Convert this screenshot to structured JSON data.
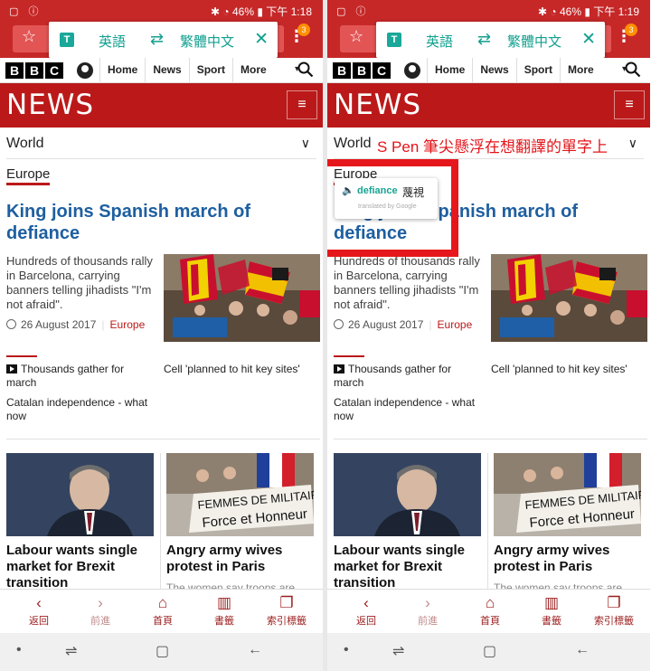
{
  "colors": {
    "brand_red": "#bb1919",
    "accent_teal": "#12a08f",
    "annotation_red": "#e6171c"
  },
  "screens": [
    {
      "status": {
        "battery": "46%",
        "time": "下午 1:18"
      },
      "translate_bar": {
        "source_lang": "英語",
        "target_lang": "繁體中文",
        "badge": "3",
        "swap_icon": "swap-arrows-icon",
        "close_icon": "close-icon"
      },
      "bbc": {
        "logo": [
          "B",
          "B",
          "C"
        ],
        "nav": [
          "Home",
          "News",
          "Sport",
          "More"
        ]
      },
      "news_title": "NEWS",
      "section": "World",
      "subsection": "Europe",
      "headline": "King joins Spanish march of defiance",
      "summary": "Hundreds of thousands rally in Barcelona, carrying banners telling jihadists \"I'm not afraid\".",
      "date": "26 August 2017",
      "tag": "Europe",
      "related": [
        "Thousands gather for march",
        "Cell 'planned to hit key sites'",
        "Catalan independence - what now"
      ],
      "story2": "Labour wants single market for Brexit transition",
      "story3": "Angry army wives protest in Paris",
      "story3_sub": "The women say troops are",
      "bottom_nav": [
        "返回",
        "前進",
        "首頁",
        "書籤",
        "索引標籤"
      ]
    },
    {
      "status": {
        "battery": "46%",
        "time": "下午 1:19"
      },
      "translate_bar": {
        "source_lang": "英語",
        "target_lang": "繁體中文",
        "badge": "3",
        "swap_icon": "swap-arrows-icon",
        "close_icon": "close-icon"
      },
      "bbc": {
        "logo": [
          "B",
          "B",
          "C"
        ],
        "nav": [
          "Home",
          "News",
          "Sport",
          "More"
        ]
      },
      "news_title": "NEWS",
      "section": "World",
      "subsection": "Europe",
      "headline": "King joins Spanish march of defiance",
      "summary": "Hundreds of thousands rally in Barcelona, carrying banners telling jihadists \"I'm not afraid\".",
      "date": "26 August 2017",
      "tag": "Europe",
      "related": [
        "Thousands gather for march",
        "Cell 'planned to hit key sites'",
        "Catalan independence - what now"
      ],
      "story2": "Labour wants single market for Brexit transition",
      "story3": "Angry army wives protest in Paris",
      "story3_sub": "The women say troops are",
      "bottom_nav": [
        "返回",
        "前進",
        "首頁",
        "書籤",
        "索引標籤"
      ],
      "annotation": {
        "caption": "S Pen 筆尖懸浮在想翻譯的單字上",
        "popup_word": "defiance",
        "popup_translation": "蔑視",
        "popup_credit": "translated by Google"
      }
    }
  ]
}
